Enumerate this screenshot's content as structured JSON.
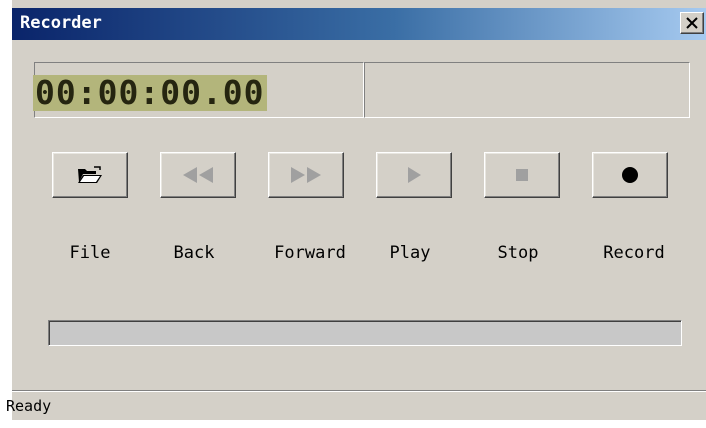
{
  "window": {
    "title": "Recorder",
    "close_symbol": "✕"
  },
  "display": {
    "timecode": "00:00:00.00",
    "info_text": ""
  },
  "controls": [
    {
      "name": "file",
      "label": "File",
      "icon": "open-folder-icon",
      "enabled": true
    },
    {
      "name": "back",
      "label": "Back",
      "icon": "rewind-icon",
      "enabled": false
    },
    {
      "name": "forward",
      "label": "Forward",
      "icon": "fast-forward-icon",
      "enabled": false
    },
    {
      "name": "play",
      "label": "Play",
      "icon": "play-icon",
      "enabled": false
    },
    {
      "name": "stop",
      "label": "Stop",
      "icon": "stop-icon",
      "enabled": false
    },
    {
      "name": "record",
      "label": "Record",
      "icon": "record-icon",
      "enabled": true
    }
  ],
  "progress": {
    "value": 0
  },
  "status": {
    "text": "Ready"
  },
  "colors": {
    "titlebar_start": "#0a246a",
    "titlebar_end": "#a6caf0",
    "window_face": "#d4d0c8",
    "lcd_background": "#b3b57b",
    "lcd_digits": "#252510",
    "disabled_icon": "#a0a0a0"
  }
}
